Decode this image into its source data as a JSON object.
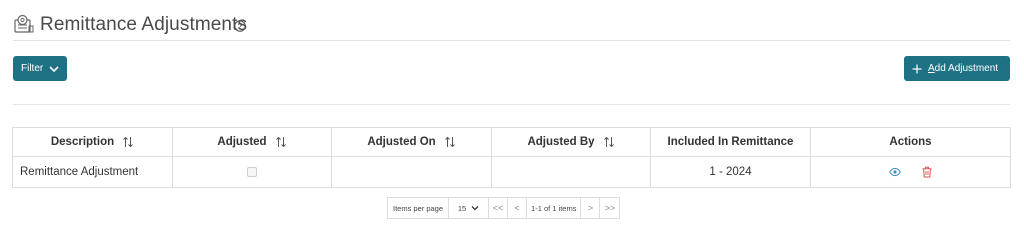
{
  "page": {
    "title": "Remittance Adjustments"
  },
  "toolbar": {
    "filter_label": "Filter",
    "add_label_prefix": "+",
    "add_label_accel": "A",
    "add_label_rest": "dd Adjustment"
  },
  "table": {
    "columns": [
      "Description",
      "Adjusted",
      "Adjusted On",
      "Adjusted By",
      "Included In Remittance",
      "Actions"
    ],
    "rows": [
      {
        "description": "Remittance Adjustment",
        "adjusted": false,
        "adjusted_on": "",
        "adjusted_by": "",
        "included_in_remittance": "1 - 2024"
      }
    ]
  },
  "pagination": {
    "items_per_page_label": "Items per page",
    "items_per_page_value": "15",
    "first": "<<",
    "prev": "<",
    "info": "1-1 of 1 items",
    "next": ">",
    "last": ">>"
  },
  "colors": {
    "accent": "#1f7286",
    "view_icon": "#3a8fb7",
    "delete_icon": "#d9534f"
  }
}
